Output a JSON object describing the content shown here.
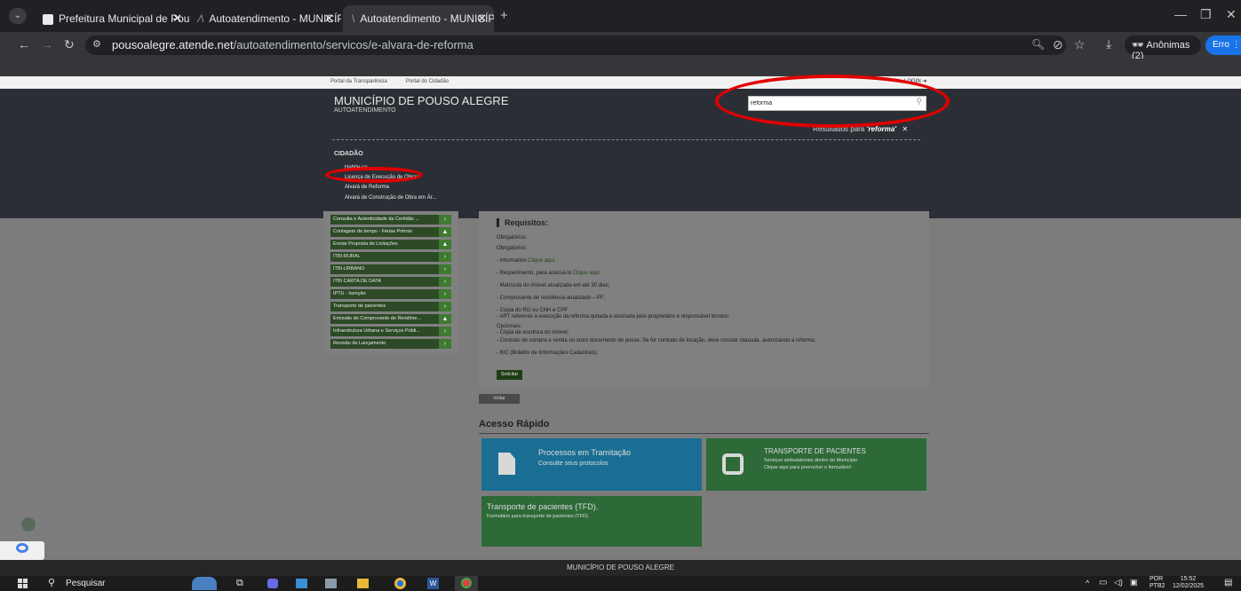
{
  "browser": {
    "tabs": [
      {
        "title": "Prefeitura Municipal de Pouso /"
      },
      {
        "title": "Autoatendimento - MUNICÍPIO"
      },
      {
        "title": "Autoatendimento - MUNICÍPIO"
      }
    ],
    "url_domain": "pousoalegre.atende.net",
    "url_path": "/autoatendimento/servicos/e-alvara-de-reforma",
    "incognito_label": "Anônimas (2)",
    "error_label": "Erro"
  },
  "site": {
    "top_links": [
      "Portal da Transparência",
      "Portal do Cidadão"
    ],
    "login_label": "LOGIN",
    "title": "MUNICÍPIO DE POUSO ALEGRE",
    "subtitle": "AUTOATENDIMENTO",
    "search": {
      "value": "reforma"
    },
    "results_prefix": "Resultados para ",
    "results_term": "'reforma'",
    "results_category": "CIDADÃO",
    "results": [
      "Habite-se",
      "Licença de Execução de Obras",
      "Alvará de Reforma",
      "Alvará de Construção de Obra em Ár..."
    ]
  },
  "sidebar": {
    "items": [
      {
        "label": "Consulta e Autenticidade da Certidão ...",
        "icon": "chevron-right-icon"
      },
      {
        "label": "Contagem de tempo - Férias Prêmio",
        "icon": "lock-icon"
      },
      {
        "label": "Enviar Proposta de Licitações",
        "icon": "lock-icon"
      },
      {
        "label": "ITBI-RURAL",
        "icon": "chevron-right-icon"
      },
      {
        "label": "ITBI-URBANO",
        "icon": "chevron-right-icon"
      },
      {
        "label": "ITBI CARTA DE DATA",
        "icon": "chevron-right-icon"
      },
      {
        "label": "IPTU - Isenção",
        "icon": "chevron-right-icon"
      },
      {
        "label": "Transporte de pacientes",
        "icon": "chevron-right-icon"
      },
      {
        "label": "Emissão do Comprovante de Rendime...",
        "icon": "lock-icon"
      },
      {
        "label": "Infraestrutura Urbana e Serviços Públi...",
        "icon": "chevron-right-icon"
      },
      {
        "label": "Revisão de Lançamento",
        "icon": "chevron-right-icon"
      }
    ]
  },
  "content": {
    "heading": "Requisitos:",
    "obrigatorios_1": "Obrigatórios:",
    "obrigatorios_2": "Obrigatórios:",
    "info_text": "- Informativo ",
    "info_link": "Clique aqui.",
    "req_text": "- Requerimento, para acessá-lo ",
    "req_link": "Clique aqui.",
    "matricula": "- Matrícula do imóvel atualizada em até 30 dias;",
    "comprovante": "- Comprovante de residência atualizado – PF;",
    "copia_rg": "- Cópia do RG ou CNH e CPF",
    "art": "- ART referente à execução da reforma quitada e assinada pelo proprietário e responsável técnico;",
    "opcionais": "Opcionais:",
    "escritura": "- Cópia de escritura do imóvel;",
    "contrato": "- Contrato de compra e venda ou outro documento de posse. Se for contrato de locação, deve constar clausula, autorizando a reforma;",
    "bic": "- BIC (Boletim de Informações Cadastrais).",
    "solicitar": "Solicitar",
    "voltar": "Voltar"
  },
  "quick_access": {
    "title": "Acesso Rápido",
    "tiles": [
      {
        "title": "Processos em Tramitação",
        "desc": "Consulte seus protocolos",
        "color": "#1a6e93"
      },
      {
        "title": "TRANSPORTE DE PACIENTES",
        "desc1": "Serviços ambulatoriais dentro do Município",
        "desc2": "Clique aqui para preencher o formulário!",
        "color": "#2d6a37"
      },
      {
        "title": "Transporte de pacientes (TFD).",
        "desc": "Formulário para transporte de pacientes (TFD).",
        "color": "#2d6a37"
      }
    ]
  },
  "footer": {
    "text": "MUNICÍPIO DE POUSO ALEGRE"
  },
  "taskbar": {
    "search": "Pesquisar",
    "lang1": "POR",
    "lang2": "PTB2",
    "time": "15:52",
    "date": "12/02/2025"
  }
}
